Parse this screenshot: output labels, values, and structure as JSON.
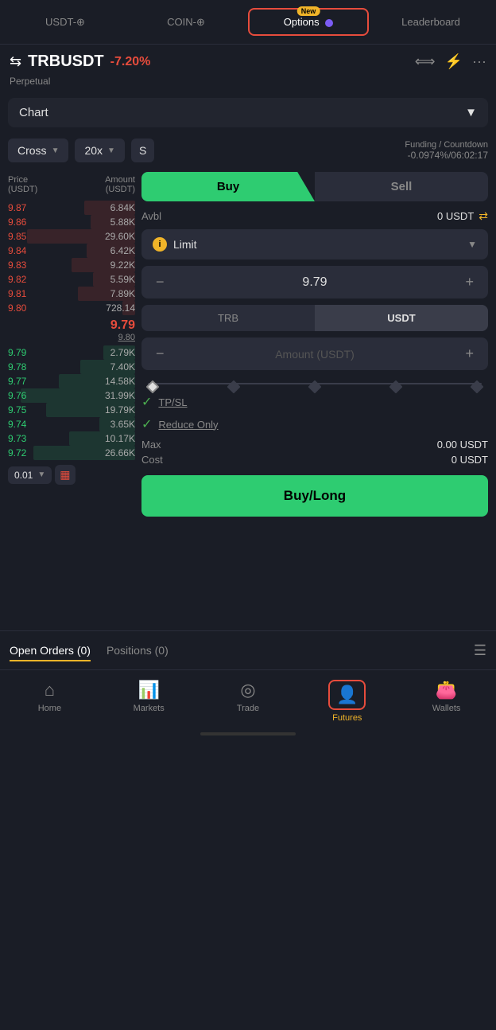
{
  "tabs": {
    "usdt": "USDT-⊕",
    "coin": "COIN-⊕",
    "options": "Options",
    "options_badge": "New",
    "leaderboard": "Leaderboard"
  },
  "header": {
    "pair": "TRBUSDT",
    "change": "-7.20%",
    "subtitle": "Perpetual"
  },
  "chart_section": {
    "label": "Chart"
  },
  "controls": {
    "cross": "Cross",
    "leverage": "20x",
    "s": "S",
    "funding_label": "Funding / Countdown",
    "funding_value": "-0.0974%/06:02:17"
  },
  "order_book": {
    "col1": "Price",
    "col1_sub": "(USDT)",
    "col2": "Amount",
    "col2_sub": "(USDT)",
    "sell_orders": [
      {
        "price": "9.87",
        "amount": "6.84K",
        "bar": 40
      },
      {
        "price": "9.86",
        "amount": "5.88K",
        "bar": 35
      },
      {
        "price": "9.85",
        "amount": "29.60K",
        "bar": 85
      },
      {
        "price": "9.84",
        "amount": "6.42K",
        "bar": 38
      },
      {
        "price": "9.83",
        "amount": "9.22K",
        "bar": 50
      },
      {
        "price": "9.82",
        "amount": "5.59K",
        "bar": 33
      },
      {
        "price": "9.81",
        "amount": "7.89K",
        "bar": 45
      },
      {
        "price": "9.80",
        "amount": "728.14",
        "bar": 10
      }
    ],
    "current_price": "9.79",
    "mark_price": "9.80",
    "buy_orders": [
      {
        "price": "9.79",
        "amount": "2.79K",
        "bar": 25
      },
      {
        "price": "9.78",
        "amount": "7.40K",
        "bar": 43
      },
      {
        "price": "9.77",
        "amount": "14.58K",
        "bar": 60
      },
      {
        "price": "9.76",
        "amount": "31.99K",
        "bar": 90
      },
      {
        "price": "9.75",
        "amount": "19.79K",
        "bar": 70
      },
      {
        "price": "9.74",
        "amount": "3.65K",
        "bar": 28
      },
      {
        "price": "9.73",
        "amount": "10.17K",
        "bar": 52
      },
      {
        "price": "9.72",
        "amount": "26.66K",
        "bar": 80
      }
    ]
  },
  "trade_panel": {
    "buy_label": "Buy",
    "sell_label": "Sell",
    "avbl_label": "Avbl",
    "avbl_value": "0 USDT",
    "order_type": "Limit",
    "price_value": "9.79",
    "trb_label": "TRB",
    "usdt_label": "USDT",
    "amount_placeholder": "Amount (USDT)",
    "tp_sl_label": "TP/SL",
    "reduce_only_label": "Reduce Only",
    "max_cost_label": "Max",
    "cost_label": "Cost",
    "max_cost_value": "0.00 USDT",
    "cost_value": "0 USDT",
    "buy_long_label": "Buy/Long"
  },
  "bottom": {
    "open_orders_label": "Open Orders (0)",
    "positions_label": "Positions (0)"
  },
  "nav": {
    "home": "Home",
    "markets": "Markets",
    "trade": "Trade",
    "futures": "Futures",
    "wallets": "Wallets"
  },
  "misc": {
    "tick_size": "0.01"
  }
}
